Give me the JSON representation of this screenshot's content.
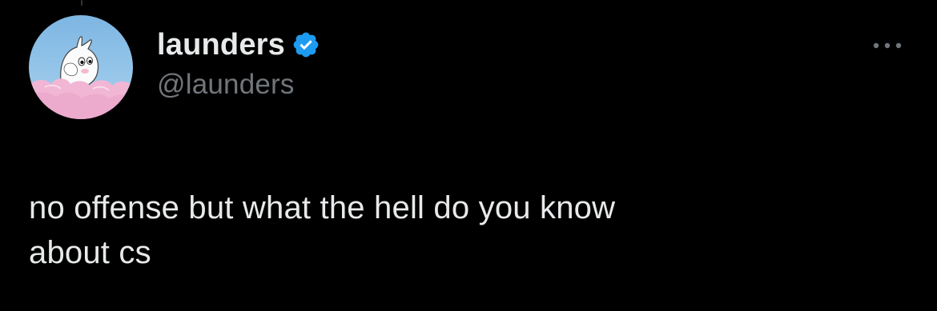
{
  "tweet": {
    "author": {
      "display_name": "launders",
      "handle": "@launders",
      "verified": true,
      "avatar_icon": "moomin-avatar-icon"
    },
    "text": "no offense but what the hell do you know\nabout cs",
    "more_icon": "more-dots-icon"
  },
  "colors": {
    "background": "#000000",
    "primary_text": "#e7e9ea",
    "secondary_text": "#71767b",
    "verified_blue": "#1d9bf0",
    "avatar_sky": "#8fc3e8",
    "avatar_cloud": "#f3b7d6"
  }
}
